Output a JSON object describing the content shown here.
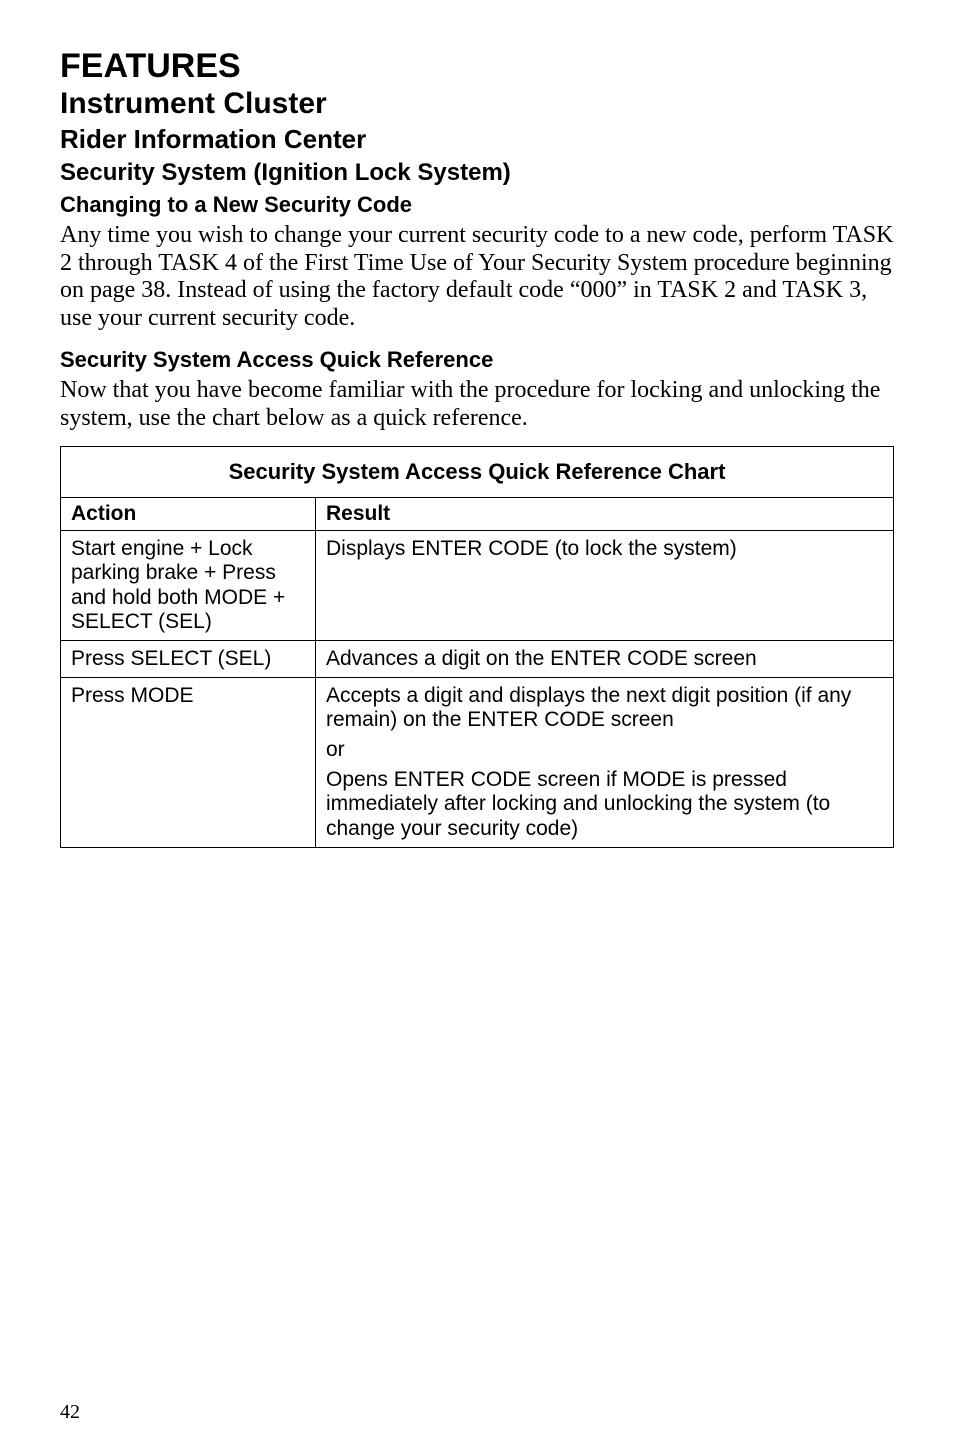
{
  "headings": {
    "h1": "FEATURES",
    "h2": "Instrument Cluster",
    "h3": "Rider Information Center",
    "h4": "Security System (Ignition Lock System)",
    "h5a": "Changing to a New Security Code",
    "h5b": "Security System Access Quick Reference"
  },
  "paragraphs": {
    "p1": "Any time you wish to change your current security code to a new code, perform TASK 2 through TASK 4 of the First Time Use of Your Security System procedure beginning on page 38. Instead of using the factory default code “000” in TASK 2 and TASK 3, use your current security code.",
    "p2": "Now that you have become familiar with the procedure for locking and unlocking the system, use the chart below as a quick reference."
  },
  "chart_data": {
    "type": "table",
    "title": "Security System Access Quick Reference Chart",
    "columns": [
      "Action",
      "Result"
    ],
    "rows": [
      {
        "action": "Start engine + Lock parking brake + Press and hold both MODE + SELECT (SEL)",
        "result": "Displays ENTER CODE (to lock the system)"
      },
      {
        "action": "Press SELECT (SEL)",
        "result": "Advances a digit on the ENTER CODE screen"
      },
      {
        "action": "Press MODE",
        "result_parts": [
          "Accepts a digit and displays the next digit position (if any remain) on the ENTER CODE screen",
          "or",
          "Opens ENTER CODE screen if MODE is pressed immediately after locking and unlocking the system (to change your security code)"
        ]
      }
    ]
  },
  "page_number": "42"
}
